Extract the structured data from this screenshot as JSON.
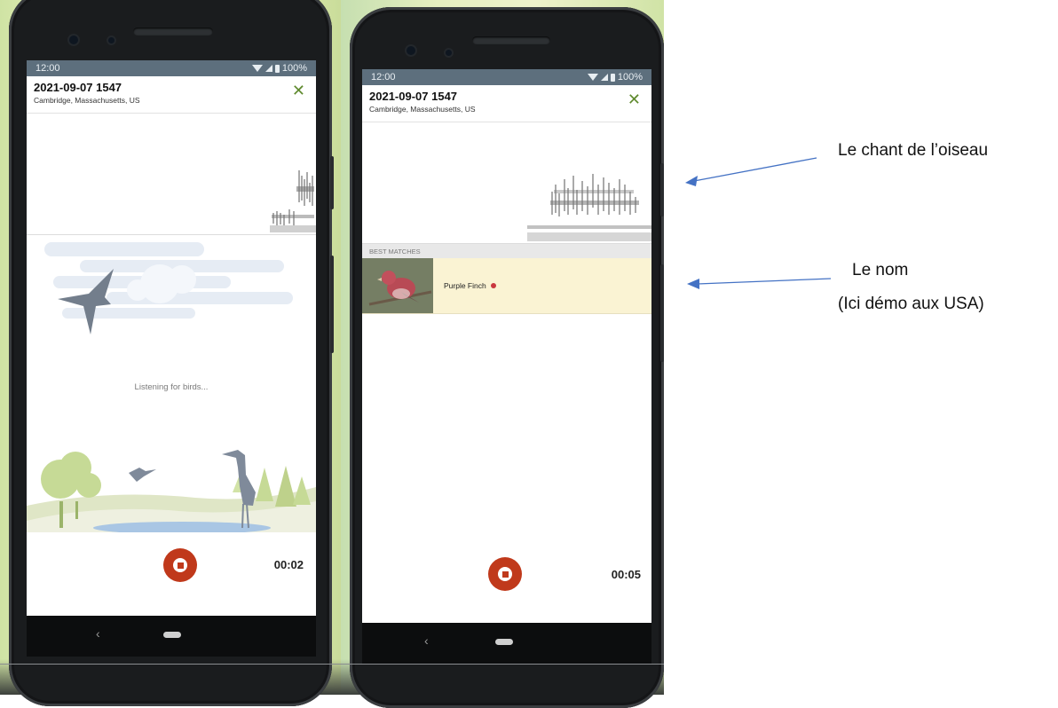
{
  "phone1": {
    "status": {
      "time": "12:00",
      "battery": "100%"
    },
    "header": {
      "title": "2021-09-07 1547",
      "location": "Cambridge, Massachusetts, US"
    },
    "listening_text": "Listening for birds...",
    "timer": "00:02",
    "nav": {
      "back_icon": "‹"
    }
  },
  "phone2": {
    "status": {
      "time": "12:00",
      "battery": "100%"
    },
    "header": {
      "title": "2021-09-07 1547",
      "location": "Cambridge, Massachusetts, US"
    },
    "best_matches_label": "BEST MATCHES",
    "matches": [
      {
        "name": "Purple Finch"
      }
    ],
    "timer": "00:05",
    "nav": {
      "back_icon": "‹"
    }
  },
  "annotations": {
    "song": "Le chant de l’oiseau",
    "name": "Le nom",
    "note": "(Ici démo aux USA)"
  },
  "colors": {
    "accent_green": "#5f8a2e",
    "record_red": "#c0391b",
    "match_bg": "#faf3d3",
    "status_bar": "#5d6f7d",
    "arrow_blue": "#4472c4"
  },
  "icons": {
    "close": "close-icon",
    "stop": "stop-icon",
    "back": "back-icon",
    "home": "home-icon",
    "wifi": "wifi-icon",
    "signal": "signal-icon",
    "battery": "battery-icon"
  }
}
